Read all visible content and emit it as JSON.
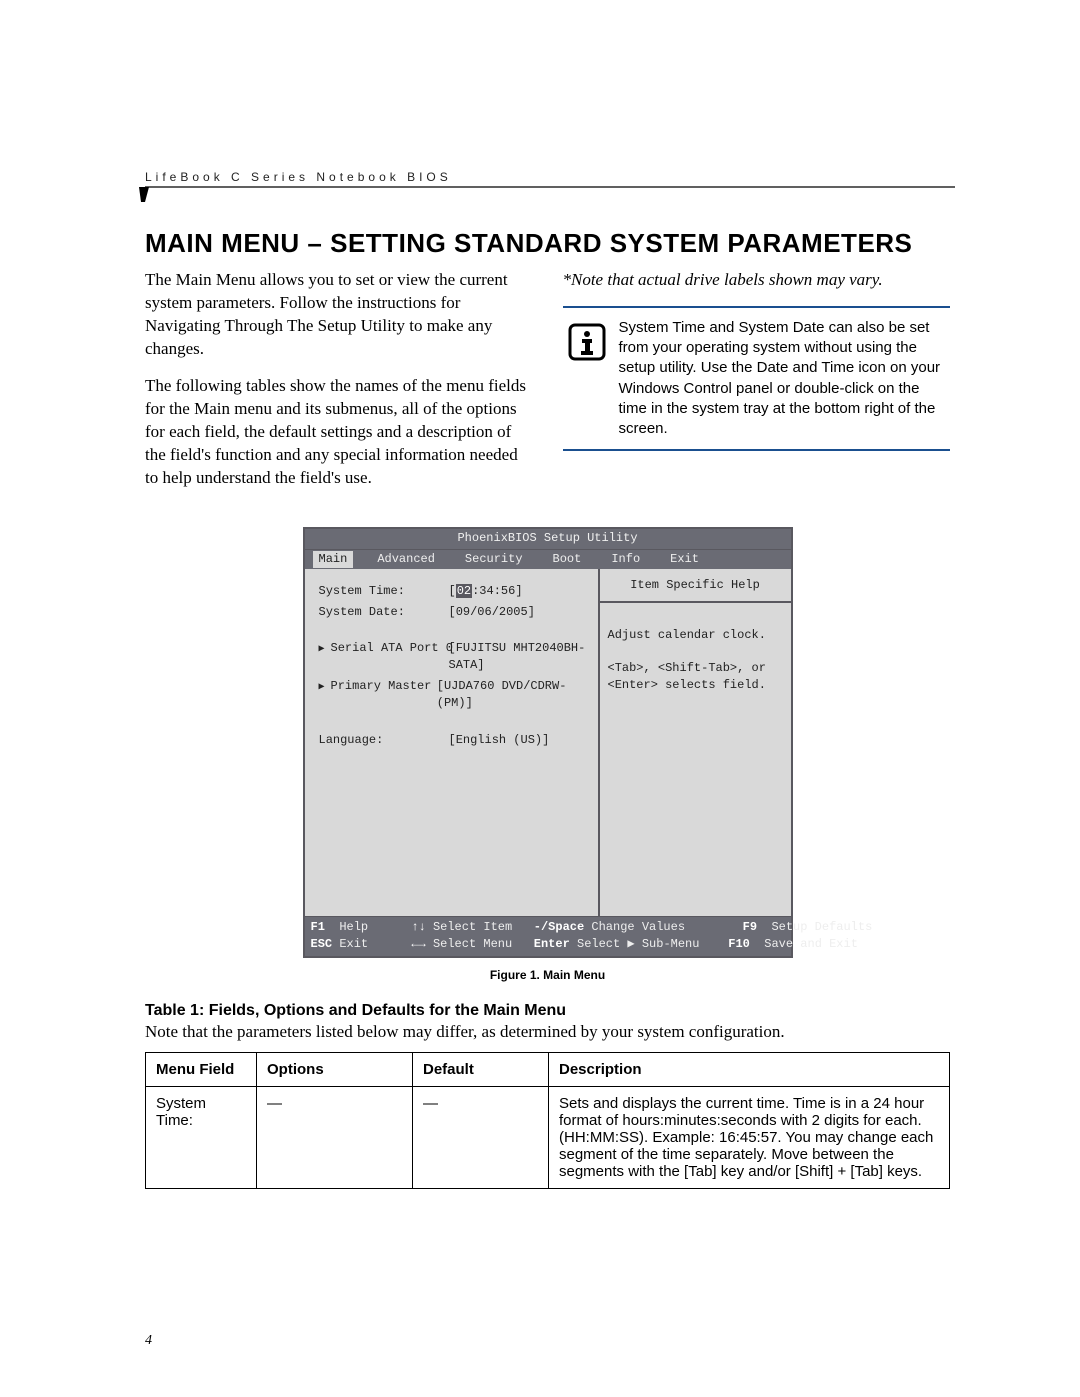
{
  "running_head": "LifeBook C Series Notebook BIOS",
  "page_title": "MAIN MENU – SETTING STANDARD SYSTEM PARAMETERS",
  "intro_para_1": "The Main Menu allows you to set or view the current system parameters. Follow the instructions for Navigating Through The Setup Utility to make any changes.",
  "intro_para_2": "The following tables show the names of the menu fields for the Main menu and its submenus, all of the options for each field, the default settings and a description of the field's function and any special information needed to help understand the field's use.",
  "note_italic": "*Note that actual drive labels shown may vary.",
  "callout": "System Time and System Date can also be set from your operating system without using the setup utility. Use the Date and Time icon on your Windows Control panel or double-click on the time in the system tray at the bottom right of the screen.",
  "bios": {
    "title": "PhoenixBIOS Setup Utility",
    "tabs": [
      "Main",
      "Advanced",
      "Security",
      "Boot",
      "Info",
      "Exit"
    ],
    "active_tab": "Main",
    "rows": {
      "system_time_label": "System Time:",
      "system_time_value": "[02:34:56]",
      "system_time_hl": "02",
      "system_time_rest": ":34:56]",
      "system_date_label": "System Date:",
      "system_date_value": "[09/06/2005]",
      "sata_label": "Serial ATA Port 0",
      "sata_value": "[FUJITSU MHT2040BH-SATA]",
      "pm_label": "Primary Master",
      "pm_value": "[UJDA760 DVD/CDRW-(PM)]",
      "lang_label": "Language:",
      "lang_value": "[English (US)]"
    },
    "help": {
      "title": "Item Specific Help",
      "line1": "Adjust calendar clock.",
      "line2": "<Tab>, <Shift-Tab>, or",
      "line3": "<Enter> selects field."
    },
    "footer": {
      "f1": "F1",
      "help": "Help",
      "sel_item": "Select Item",
      "minus_space": "-/Space",
      "change_values": "Change Values",
      "f9": "F9",
      "setup_defaults": "Setup Defaults",
      "esc": "ESC",
      "exit": "Exit",
      "sel_menu": "Select Menu",
      "enter": "Enter",
      "sel_sub": "Select ▶ Sub-Menu",
      "f10": "F10",
      "save_exit": "Save and Exit"
    }
  },
  "figure_caption": "Figure 1.  Main Menu",
  "table_title": "Table 1: Fields, Options and Defaults for the Main Menu",
  "table_note": "Note that the parameters listed below may differ, as determined by your system configuration.",
  "table_headers": {
    "menu": "Menu Field",
    "options": "Options",
    "default": "Default",
    "desc": "Description"
  },
  "table_rows": [
    {
      "menu": "System Time:",
      "options": "—",
      "default": "—",
      "desc": "Sets and displays the current time. Time is in a 24 hour format of hours:minutes:seconds with 2 digits for each. (HH:MM:SS). Example: 16:45:57. You may change each segment of the time separately. Move between the segments with the [Tab] key and/or [Shift] + [Tab] keys."
    }
  ],
  "page_number": "4"
}
